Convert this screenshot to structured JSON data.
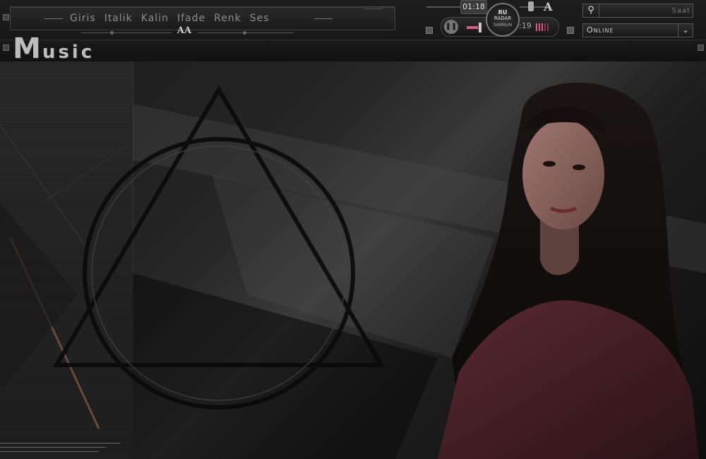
{
  "menu": {
    "items": [
      "Giris",
      "Italik",
      "Kalin",
      "Ifade",
      "Renk",
      "Ses"
    ]
  },
  "brand": {
    "logo_text": "AA",
    "title_first": "M",
    "title_rest": "usic"
  },
  "player": {
    "time_bubble": "01:18",
    "time_text": ":19",
    "radio_line1": "RU",
    "radio_line2": "RADAR",
    "radio_line3": "SAMSUN",
    "volume_letter": "A",
    "progress": 0.25,
    "volume": 0.75
  },
  "search": {
    "placeholder": "Saat",
    "value": ""
  },
  "status_select": {
    "selected": "Online"
  },
  "colors": {
    "accent": "#e05a87",
    "panel": "#1d1d1d"
  },
  "icons": {
    "search": "magnifier-icon",
    "dropdown": "chevron-down-icon",
    "pause": "pause-icon"
  }
}
